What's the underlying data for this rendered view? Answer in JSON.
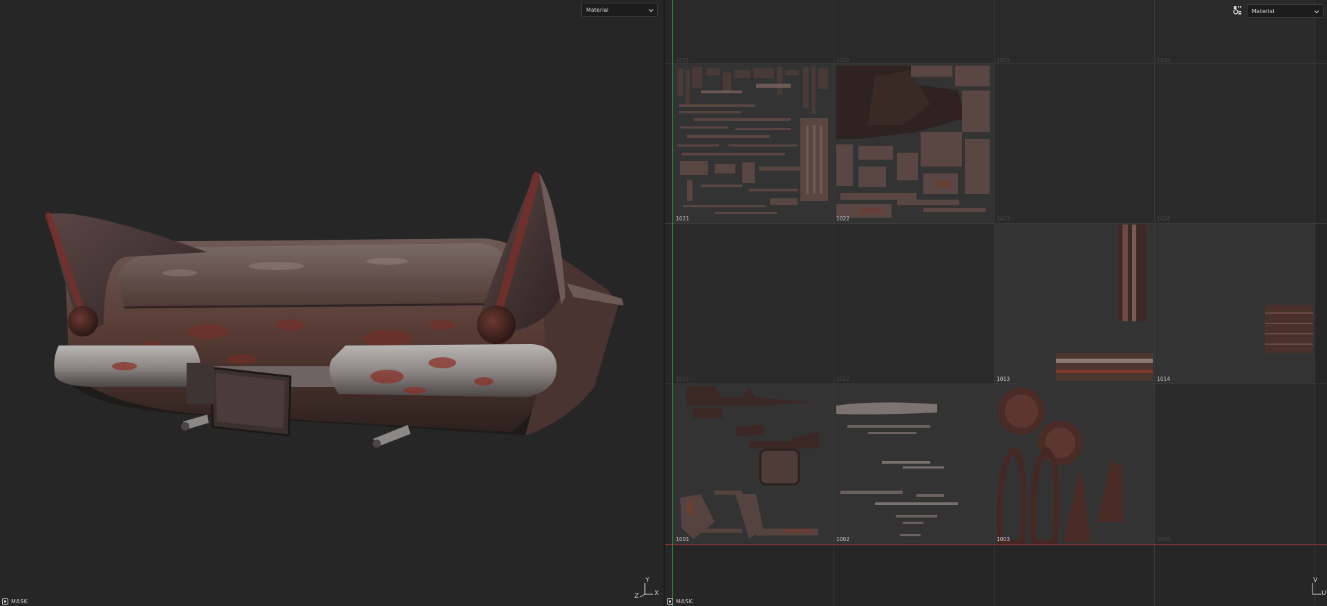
{
  "viewport_3d": {
    "mode_dropdown": {
      "value": "Material"
    },
    "status": {
      "label": "MASK"
    },
    "gizmo": {
      "y": "Y",
      "z": "Z",
      "x": "X"
    }
  },
  "viewport_2d": {
    "mode_dropdown": {
      "value": "Material"
    },
    "view_icon": "display-settings-icon",
    "status": {
      "label": "MASK"
    },
    "gizmo": {
      "v": "V",
      "u": "U"
    },
    "tiles": [
      {
        "id": "1031",
        "label": "1031",
        "state": "empty",
        "label_pos": "top"
      },
      {
        "id": "1032",
        "label": "1032",
        "state": "empty",
        "label_pos": "top"
      },
      {
        "id": "1033",
        "label": "1033",
        "state": "empty",
        "label_pos": "top"
      },
      {
        "id": "1034",
        "label": "1034",
        "state": "empty",
        "label_pos": "top"
      },
      {
        "id": "1021",
        "label": "1021",
        "state": "filled"
      },
      {
        "id": "1022",
        "label": "1022",
        "state": "filled"
      },
      {
        "id": "1023",
        "label": "1023",
        "state": "empty"
      },
      {
        "id": "1024",
        "label": "1024",
        "state": "empty"
      },
      {
        "id": "1011",
        "label": "1011",
        "state": "empty"
      },
      {
        "id": "1012",
        "label": "1012",
        "state": "empty"
      },
      {
        "id": "1013",
        "label": "1013",
        "state": "filled"
      },
      {
        "id": "1014",
        "label": "1014",
        "state": "filled"
      },
      {
        "id": "1001",
        "label": "1001",
        "state": "filled"
      },
      {
        "id": "1002",
        "label": "1002",
        "state": "filled"
      },
      {
        "id": "1003",
        "label": "1003",
        "state": "filled"
      },
      {
        "id": "1004",
        "label": "1004",
        "state": "empty"
      }
    ]
  },
  "colors": {
    "background": "#262626",
    "u_axis": "#d23a3a",
    "v_axis": "#33c24a",
    "rust": "#6b3a2e",
    "chrome": "#9a9a9c"
  }
}
